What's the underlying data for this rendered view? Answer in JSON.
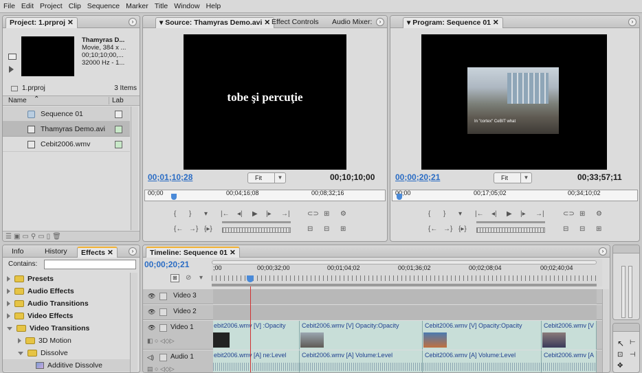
{
  "menu": [
    "File",
    "Edit",
    "Project",
    "Clip",
    "Sequence",
    "Marker",
    "Title",
    "Window",
    "Help"
  ],
  "project": {
    "tab_label": "Project: 1.prproj",
    "preview_info": [
      "Thamyras D...",
      "Movie, 384 x ...",
      "00;10;10;00,...",
      "32000 Hz - 1..."
    ],
    "bin_name": "1.prproj",
    "item_count": "3 Items",
    "col_name": "Name",
    "col_label": "Lab",
    "items": [
      {
        "name": "Sequence 01",
        "type": "sequence"
      },
      {
        "name": "Thamyras Demo.avi",
        "type": "video"
      },
      {
        "name": "Cebit2006.wmv",
        "type": "video"
      }
    ]
  },
  "source": {
    "tabs": [
      "Source: Thamyras Demo.avi",
      "Effect Controls",
      "Audio Mixer:"
    ],
    "frame_text": "tobe şi percuţie",
    "timecode_current": "00;01;10;28",
    "fit": "Fit",
    "timecode_duration": "00;10;10;00",
    "ruler_labels": [
      "00;00",
      "00;04;16;08",
      "00;08;32;16"
    ]
  },
  "program": {
    "tab_label": "Program: Sequence 01",
    "subtitle_text": "In \"cortex\" CeBIT what",
    "timecode_current": "00;00;20;21",
    "fit": "Fit",
    "timecode_duration": "00;33;57;11",
    "ruler_labels": [
      "00;00",
      "00;17;05;02",
      "00;34;10;02"
    ]
  },
  "effects": {
    "tabs": [
      "Info",
      "History",
      "Effects"
    ],
    "contains_label": "Contains:",
    "tree": [
      {
        "label": "Presets",
        "level": 0,
        "bold": true
      },
      {
        "label": "Audio Effects",
        "level": 0,
        "bold": true
      },
      {
        "label": "Audio Transitions",
        "level": 0,
        "bold": true
      },
      {
        "label": "Video Effects",
        "level": 0,
        "bold": true
      },
      {
        "label": "Video Transitions",
        "level": 0,
        "bold": true,
        "open": true
      },
      {
        "label": "3D Motion",
        "level": 1
      },
      {
        "label": "Dissolve",
        "level": 1,
        "open": true
      },
      {
        "label": "Additive Dissolve",
        "level": 2
      }
    ]
  },
  "timeline": {
    "tab_label": "Timeline: Sequence 01",
    "timecode": "00;00;20;21",
    "ruler_labels": [
      ";00",
      "00;00;32;00",
      "00;01;04;02",
      "00;01;36;02",
      "00;02;08;04",
      "00;02;40;04"
    ],
    "tracks": [
      {
        "name": "Video 3"
      },
      {
        "name": "Video 2"
      },
      {
        "name": "Video 1"
      },
      {
        "name": "Audio 1"
      }
    ],
    "video1_clips": [
      "ebit2006.wmv [V] :Opacity",
      "Cebit2006.wmv [V] Opacity:Opacity",
      "Cebit2006.wmv [V] Opacity:Opacity",
      "Cebit2006.wmv [V"
    ],
    "audio1_clips": [
      "ebit2006.wmv [A] ne:Level",
      "Cebit2006.wmv [A] Volume:Level",
      "Cebit2006.wmv [A] Volume:Level",
      "Cebit2006.wmv [A"
    ]
  },
  "colors": {
    "accent_blue": "#2a6cc4",
    "clip_teal": "#c8ded8",
    "playhead_red": "#d03030",
    "tab_orange": "#f2b233"
  }
}
